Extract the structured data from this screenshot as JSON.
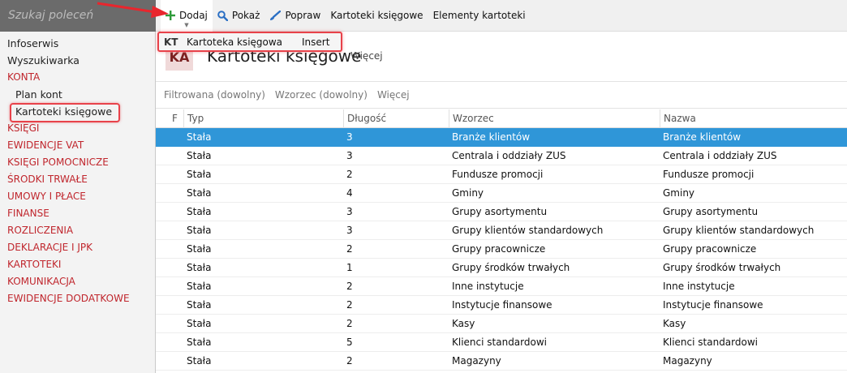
{
  "search": {
    "placeholder": "Szukaj poleceń"
  },
  "toolbar": {
    "add": "Dodaj",
    "show": "Pokaż",
    "edit": "Popraw",
    "ledger_cards": "Kartoteki księgowe",
    "card_elements": "Elementy kartoteki"
  },
  "dropdown": {
    "abbr": "KT",
    "label": "Kartoteka księgowa",
    "shortcut": "Insert"
  },
  "sidebar": {
    "items": [
      {
        "label": "Infoserwis",
        "kind": "nav"
      },
      {
        "label": "Wyszukiwarka",
        "kind": "nav"
      },
      {
        "label": "KONTA",
        "kind": "section"
      },
      {
        "label": "Plan kont",
        "kind": "sub"
      },
      {
        "label": "Kartoteki księgowe",
        "kind": "sub-current"
      },
      {
        "label": "KSIĘGI",
        "kind": "section"
      },
      {
        "label": "EWIDENCJE VAT",
        "kind": "section"
      },
      {
        "label": "KSIĘGI POMOCNICZE",
        "kind": "section"
      },
      {
        "label": "ŚRODKI TRWAŁE",
        "kind": "section"
      },
      {
        "label": "UMOWY I PŁACE",
        "kind": "section"
      },
      {
        "label": "FINANSE",
        "kind": "section"
      },
      {
        "label": "ROZLICZENIA",
        "kind": "section"
      },
      {
        "label": "DEKLARACJE I JPK",
        "kind": "section"
      },
      {
        "label": "KARTOTEKI",
        "kind": "section"
      },
      {
        "label": "KOMUNIKACJA",
        "kind": "section"
      },
      {
        "label": "EWIDENCJE DODATKOWE",
        "kind": "section"
      }
    ]
  },
  "header": {
    "tile": "KA",
    "title": "Kartoteki księgowe",
    "more": "Więcej"
  },
  "filters": {
    "filter": "Filtrowana (dowolny)",
    "pattern": "Wzorzec (dowolny)",
    "more": "Więcej"
  },
  "table": {
    "columns": {
      "f": "F",
      "typ": "Typ",
      "len": "Długość",
      "wz": "Wzorzec",
      "nz": "Nazwa"
    },
    "rows": [
      {
        "typ": "Stała",
        "len": "3",
        "wz": "Branże klientów",
        "nz": "Branże klientów",
        "selected": true
      },
      {
        "typ": "Stała",
        "len": "3",
        "wz": "Centrala i oddziały ZUS",
        "nz": "Centrala i oddziały ZUS"
      },
      {
        "typ": "Stała",
        "len": "2",
        "wz": "Fundusze promocji",
        "nz": "Fundusze promocji"
      },
      {
        "typ": "Stała",
        "len": "4",
        "wz": "Gminy",
        "nz": "Gminy"
      },
      {
        "typ": "Stała",
        "len": "3",
        "wz": "Grupy asortymentu",
        "nz": "Grupy asortymentu"
      },
      {
        "typ": "Stała",
        "len": "3",
        "wz": "Grupy klientów standardowych",
        "nz": "Grupy klientów standardowych"
      },
      {
        "typ": "Stała",
        "len": "2",
        "wz": "Grupy pracownicze",
        "nz": "Grupy pracownicze"
      },
      {
        "typ": "Stała",
        "len": "1",
        "wz": "Grupy środków trwałych",
        "nz": "Grupy środków trwałych"
      },
      {
        "typ": "Stała",
        "len": "2",
        "wz": "Inne instytucje",
        "nz": "Inne instytucje"
      },
      {
        "typ": "Stała",
        "len": "2",
        "wz": "Instytucje finansowe",
        "nz": "Instytucje finansowe"
      },
      {
        "typ": "Stała",
        "len": "2",
        "wz": "Kasy",
        "nz": "Kasy"
      },
      {
        "typ": "Stała",
        "len": "5",
        "wz": "Klienci standardowi",
        "nz": "Klienci standardowi"
      },
      {
        "typ": "Stała",
        "len": "2",
        "wz": "Magazyny",
        "nz": "Magazyny"
      }
    ]
  },
  "colors": {
    "accent": "#c0262d",
    "selection": "#2f96d8",
    "highlight": "#e8424a",
    "add_icon": "#2e9b3a",
    "search_icon": "#2a6fc4"
  }
}
